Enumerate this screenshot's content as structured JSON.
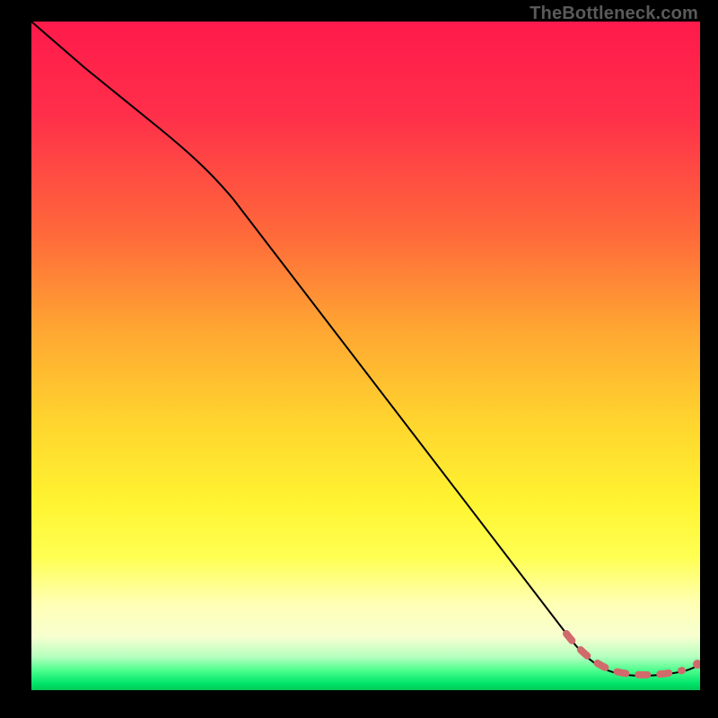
{
  "attribution": "TheBottleneck.com",
  "chart_data": {
    "type": "line",
    "title": "",
    "xlabel": "",
    "ylabel": "",
    "xlim": [
      0,
      100
    ],
    "ylim": [
      0,
      100
    ],
    "series": [
      {
        "name": "bottleneck-curve",
        "style": "solid",
        "x": [
          0,
          8,
          18,
          26,
          32,
          40,
          48,
          56,
          64,
          72,
          78,
          82,
          85
        ],
        "y": [
          100,
          93,
          85,
          78,
          71,
          61,
          50,
          40,
          29,
          18,
          10,
          5,
          3
        ]
      },
      {
        "name": "optimum-region",
        "style": "dotted-accent",
        "x": [
          82,
          85,
          88,
          91,
          94,
          97,
          100
        ],
        "y": [
          5,
          3,
          2,
          2,
          2,
          2.5,
          4
        ]
      }
    ]
  },
  "colors": {
    "curve": "#000000",
    "accent": "#d16a6a",
    "gradient_top": "#ff1a4b",
    "gradient_mid": "#fff431",
    "gradient_bottom": "#00c957"
  }
}
